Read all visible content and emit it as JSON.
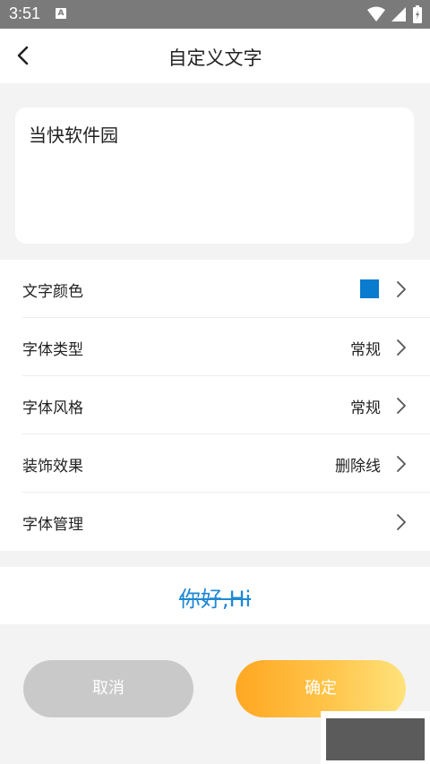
{
  "status_bar": {
    "time": "3:51",
    "notification_badge": "A",
    "icons": [
      "wifi-icon",
      "signal-icon",
      "battery-icon"
    ]
  },
  "app_bar": {
    "title": "自定义文字",
    "back_icon": "chevron-left-icon"
  },
  "text_input": {
    "value": "当快软件园"
  },
  "settings": {
    "rows": [
      {
        "label": "文字颜色",
        "value": "",
        "swatch_color": "#0a7ccf"
      },
      {
        "label": "字体类型",
        "value": "常规"
      },
      {
        "label": "字体风格",
        "value": "常规"
      },
      {
        "label": "装饰效果",
        "value": "删除线"
      },
      {
        "label": "字体管理",
        "value": ""
      }
    ]
  },
  "preview": {
    "text": "你好,Hi",
    "color": "#1e88d4",
    "decoration": "line-through"
  },
  "buttons": {
    "cancel": "取消",
    "confirm": "确定"
  }
}
